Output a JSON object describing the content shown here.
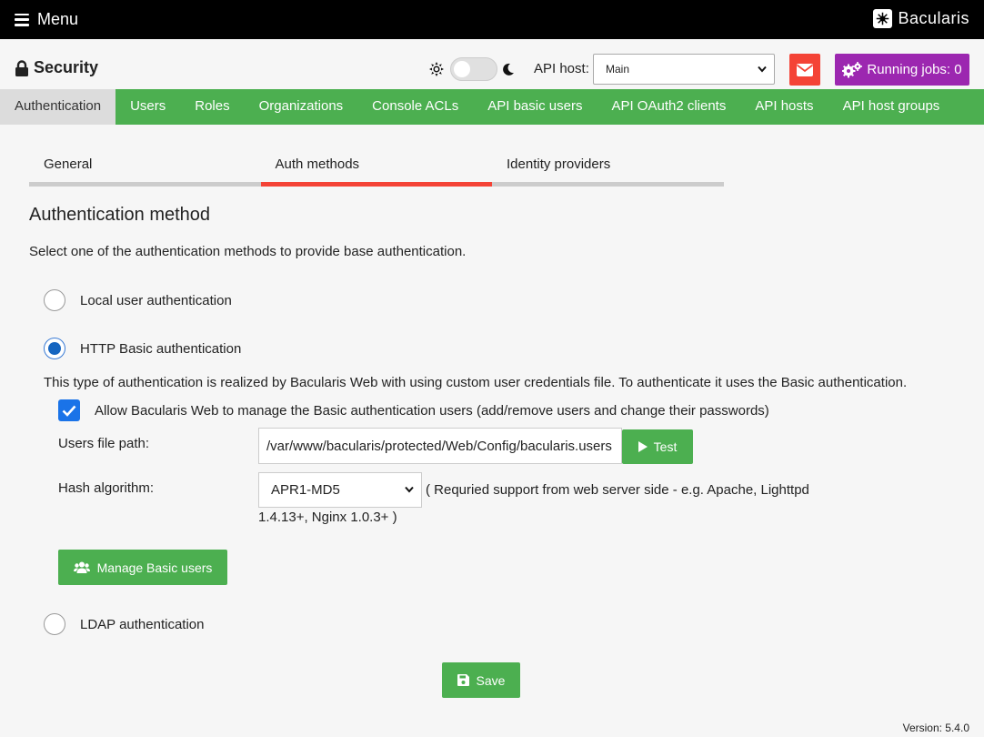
{
  "topbar": {
    "menu_label": "Menu",
    "brand_name": "Bacularis",
    "menu_icon": "hamburger-icon",
    "logo_icon": "bacularis-logo"
  },
  "header": {
    "title": "Security",
    "title_icon": "lock-icon",
    "api_host_label": "API host:",
    "api_host_value": "Main",
    "running_jobs_label": "Running jobs: 0",
    "colors": {
      "mail": "#f44336",
      "jobs": "#9c27b0"
    }
  },
  "nav": {
    "items": [
      {
        "label": "Authentication"
      },
      {
        "label": "Users"
      },
      {
        "label": "Roles"
      },
      {
        "label": "Organizations"
      },
      {
        "label": "Console ACLs"
      },
      {
        "label": "API basic users"
      },
      {
        "label": "API OAuth2 clients"
      },
      {
        "label": "API hosts"
      },
      {
        "label": "API host groups"
      }
    ],
    "active_index": 0,
    "color": "#4caf50"
  },
  "tabs": [
    {
      "label": "General"
    },
    {
      "label": "Auth methods"
    },
    {
      "label": "Identity providers"
    }
  ],
  "section": {
    "title": "Authentication method",
    "description": "Select one of the authentication methods to provide base authentication."
  },
  "methods": {
    "local": {
      "label": "Local user authentication",
      "checked": false
    },
    "basic": {
      "label": "HTTP Basic authentication",
      "checked": true
    },
    "ldap": {
      "label": "LDAP authentication",
      "checked": false
    }
  },
  "basic": {
    "info": "This type of authentication is realized by Bacularis Web with using custom user credentials file. To authenticate it uses the Basic authentication.",
    "allow_manage_label": "Allow Bacularis Web to manage the Basic authentication users (add/remove users and change their passwords)",
    "allow_manage_checked": true,
    "users_file_label": "Users file path:",
    "users_file_value": "/var/www/bacularis/protected/Web/Config/bacularis.users",
    "test_label": "Test",
    "hash_label": "Hash algorithm:",
    "hash_value": "APR1-MD5",
    "hash_note_line1": "( Requried support from web server side - e.g. Apache, Lighttpd",
    "hash_note_line2": "1.4.13+, Nginx 1.0.3+ )",
    "manage_users_label": "Manage Basic users"
  },
  "save_label": "Save",
  "version": "Version: 5.4.0"
}
